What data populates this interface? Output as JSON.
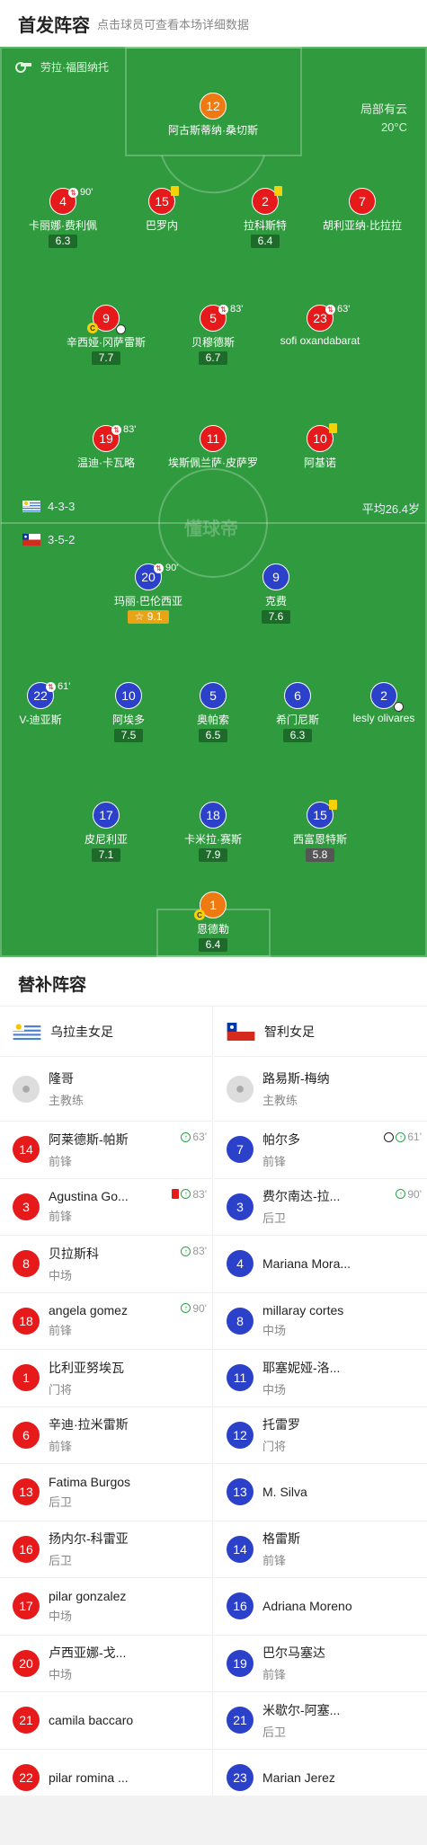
{
  "header": {
    "title": "首发阵容",
    "subtitle": "点击球员可查看本场详细数据"
  },
  "pitch": {
    "referee": "劳拉·福图纳托",
    "weather": "局部有云",
    "temperature": "20°C",
    "watermark": "懂球帝",
    "home_formation": "4-3-3",
    "away_formation": "3-5-2",
    "avg_age": "平均26.4岁"
  },
  "home_players": [
    {
      "num": "12",
      "name": "阿古斯蒂纳·桑切斯",
      "rating": "",
      "color": "orange"
    },
    {
      "num": "4",
      "name": "卡丽娜·费利佩",
      "rating": "6.3",
      "sub": "90'"
    },
    {
      "num": "15",
      "name": "巴罗内",
      "rating": "",
      "card": true
    },
    {
      "num": "2",
      "name": "拉科斯特",
      "rating": "6.4",
      "card": true
    },
    {
      "num": "7",
      "name": "胡利亚纳·比拉拉",
      "rating": ""
    },
    {
      "num": "9",
      "name": "辛西娅·冈萨雷斯",
      "rating": "7.7",
      "captain": true,
      "goal": true
    },
    {
      "num": "5",
      "name": "贝穆德斯",
      "rating": "6.7",
      "sub": "83'"
    },
    {
      "num": "23",
      "name": "sofi oxandabarat",
      "rating": "",
      "sub": "63'"
    },
    {
      "num": "19",
      "name": "温迪·卡瓦略",
      "rating": "",
      "sub": "83'"
    },
    {
      "num": "11",
      "name": "埃斯佩兰萨·皮萨罗",
      "rating": ""
    },
    {
      "num": "10",
      "name": "阿基诺",
      "rating": "",
      "card": true
    }
  ],
  "away_players": [
    {
      "num": "20",
      "name": "玛丽·巴伦西亚",
      "rating": "9.1",
      "sub": "90'",
      "best": true
    },
    {
      "num": "9",
      "name": "克费",
      "rating": "7.6"
    },
    {
      "num": "22",
      "name": "V-迪亚斯",
      "rating": "",
      "sub": "61'"
    },
    {
      "num": "10",
      "name": "阿埃多",
      "rating": "7.5"
    },
    {
      "num": "5",
      "name": "奥帕索",
      "rating": "6.5"
    },
    {
      "num": "6",
      "name": "希门尼斯",
      "rating": "6.3"
    },
    {
      "num": "2",
      "name": "lesly olivares",
      "rating": "",
      "goal": true
    },
    {
      "num": "17",
      "name": "皮尼利亚",
      "rating": "7.1"
    },
    {
      "num": "18",
      "name": "卡米拉·赛斯",
      "rating": "7.9"
    },
    {
      "num": "15",
      "name": "西富恩特斯",
      "rating": "5.8",
      "card": true
    },
    {
      "num": "1",
      "name": "恩德勒",
      "rating": "6.4",
      "captain": true,
      "color": "orange"
    }
  ],
  "subs_title": "替补阵容",
  "home_team": {
    "name": "乌拉圭女足",
    "coach": "隆哥",
    "coach_role": "主教练",
    "subs": [
      {
        "num": "14",
        "name": "阿莱德斯-帕斯",
        "pos": "前锋",
        "time": "63'",
        "ev": "in"
      },
      {
        "num": "3",
        "name": "Agustina Go...",
        "pos": "前锋",
        "time": "83'",
        "ev": "redin"
      },
      {
        "num": "8",
        "name": "贝拉斯科",
        "pos": "中场",
        "time": "83'",
        "ev": "in"
      },
      {
        "num": "18",
        "name": "angela gomez",
        "pos": "前锋",
        "time": "90'",
        "ev": "in"
      },
      {
        "num": "1",
        "name": "比利亚努埃瓦",
        "pos": "门将"
      },
      {
        "num": "6",
        "name": "辛迪·拉米雷斯",
        "pos": "前锋"
      },
      {
        "num": "13",
        "name": "Fatima Burgos",
        "pos": "后卫"
      },
      {
        "num": "16",
        "name": "扬内尔-科雷亚",
        "pos": "后卫"
      },
      {
        "num": "17",
        "name": "pilar gonzalez",
        "pos": "中场"
      },
      {
        "num": "20",
        "name": "卢西亚娜-戈...",
        "pos": "中场"
      },
      {
        "num": "21",
        "name": "camila baccaro",
        "pos": ""
      },
      {
        "num": "22",
        "name": "pilar romina ...",
        "pos": ""
      }
    ]
  },
  "away_team": {
    "name": "智利女足",
    "coach": "路易斯-梅纳",
    "coach_role": "主教练",
    "subs": [
      {
        "num": "7",
        "name": "帕尔多",
        "pos": "前锋",
        "time": "61'",
        "ev": "goalin"
      },
      {
        "num": "3",
        "name": "费尔南达-拉...",
        "pos": "后卫",
        "time": "90'",
        "ev": "in"
      },
      {
        "num": "4",
        "name": "Mariana Mora...",
        "pos": ""
      },
      {
        "num": "8",
        "name": "millaray cortes",
        "pos": "中场"
      },
      {
        "num": "11",
        "name": "耶塞妮娅-洛...",
        "pos": "中场"
      },
      {
        "num": "12",
        "name": "托雷罗",
        "pos": "门将"
      },
      {
        "num": "13",
        "name": "M. Silva",
        "pos": ""
      },
      {
        "num": "14",
        "name": "格雷斯",
        "pos": "前锋"
      },
      {
        "num": "16",
        "name": "Adriana Moreno",
        "pos": ""
      },
      {
        "num": "19",
        "name": "巴尔马塞达",
        "pos": "前锋"
      },
      {
        "num": "21",
        "name": "米歇尔-阿塞...",
        "pos": "后卫"
      },
      {
        "num": "23",
        "name": "Marian Jerez",
        "pos": ""
      }
    ]
  }
}
